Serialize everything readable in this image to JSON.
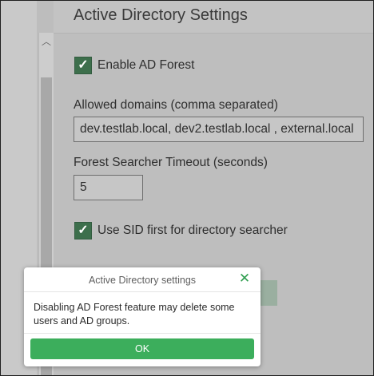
{
  "page": {
    "title": "Active Directory Settings",
    "enable_forest": {
      "label": "Enable AD Forest",
      "checked": true
    },
    "allowed_domains": {
      "label": "Allowed domains (comma separated)",
      "value": "dev.testlab.local, dev2.testlab.local , external.local"
    },
    "timeout": {
      "label": "Forest Searcher Timeout (seconds)",
      "value": "5"
    },
    "use_sid": {
      "label": "Use SID first for directory searcher",
      "checked": true
    }
  },
  "dialog": {
    "title": "Active Directory settings",
    "message": "Disabling AD Forest feature may delete some users and AD groups.",
    "ok_label": "OK",
    "close_icon": "close-icon"
  },
  "colors": {
    "accent_green": "#3cae5c",
    "checkbox_green": "#3d6f4c",
    "overlay_gray": "#bebebe"
  }
}
